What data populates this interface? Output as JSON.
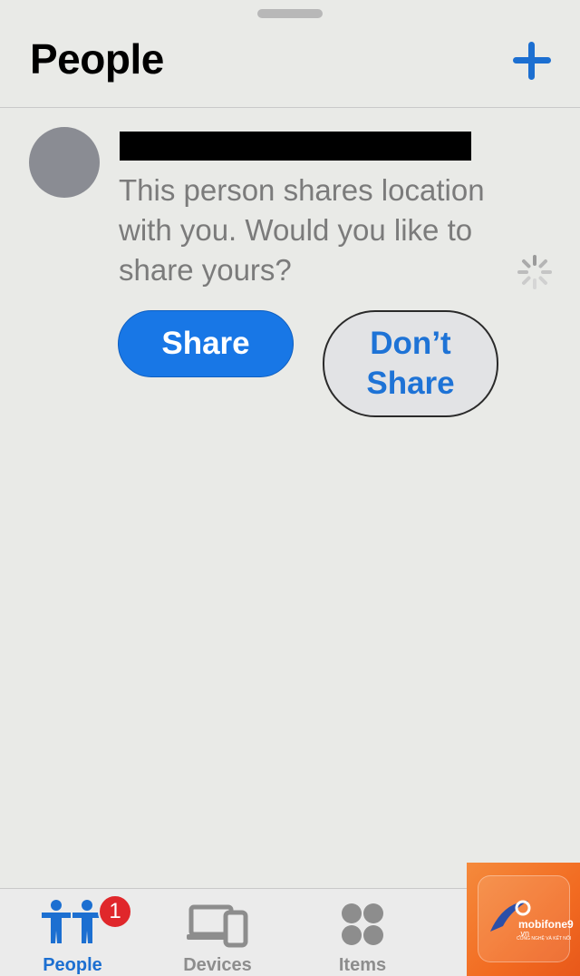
{
  "header": {
    "title": "People",
    "add_icon": "plus-icon"
  },
  "invite": {
    "message": "This person shares location with you. Would you like to share yours?",
    "share_label": "Share",
    "dont_share_line1": "Don’t",
    "dont_share_line2": "Share",
    "loading_icon": "spinner-icon"
  },
  "tabbar": {
    "tabs": [
      {
        "label": "People",
        "icon": "people-icon",
        "active": true,
        "badge": "1"
      },
      {
        "label": "Devices",
        "icon": "devices-icon",
        "active": false
      },
      {
        "label": "Items",
        "icon": "items-icon",
        "active": false
      }
    ]
  },
  "watermark": {
    "brand": "mobifone9",
    "domain": ".vn",
    "tagline": "CÔNG NGHỆ VÀ KẾT NỐI"
  },
  "colors": {
    "accent": "#1877e6",
    "badge": "#e0272b",
    "background": "#e9eae7"
  }
}
